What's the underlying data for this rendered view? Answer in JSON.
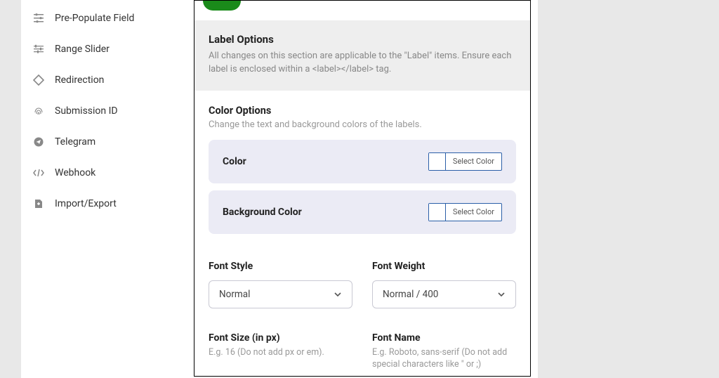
{
  "sidebar": {
    "items": [
      {
        "label": "Pre-Populate Field",
        "icon": "sliders"
      },
      {
        "label": "Range Slider",
        "icon": "sliders-h"
      },
      {
        "label": "Redirection",
        "icon": "diamond"
      },
      {
        "label": "Submission ID",
        "icon": "fingerprint"
      },
      {
        "label": "Telegram",
        "icon": "send"
      },
      {
        "label": "Webhook",
        "icon": "api"
      },
      {
        "label": "Import/Export",
        "icon": "inout"
      }
    ]
  },
  "panel": {
    "header": {
      "title": "Label Options",
      "desc": "All changes on this section are applicable to the \"Label\" items. Ensure each label is enclosed within a <label></label> tag."
    },
    "colorOptions": {
      "title": "Color Options",
      "desc": "Change the text and background colors of the labels.",
      "rows": [
        {
          "label": "Color",
          "btn": "Select Color"
        },
        {
          "label": "Background Color",
          "btn": "Select Color"
        }
      ]
    },
    "fontStyle": {
      "label": "Font Style",
      "value": "Normal"
    },
    "fontWeight": {
      "label": "Font Weight",
      "value": "Normal / 400"
    },
    "fontSize": {
      "label": "Font Size (in px)",
      "hint": "E.g. 16 (Do not add px or em)."
    },
    "fontName": {
      "label": "Font Name",
      "hint": "E.g. Roboto, sans-serif (Do not add special characters like \" or ;)"
    }
  }
}
